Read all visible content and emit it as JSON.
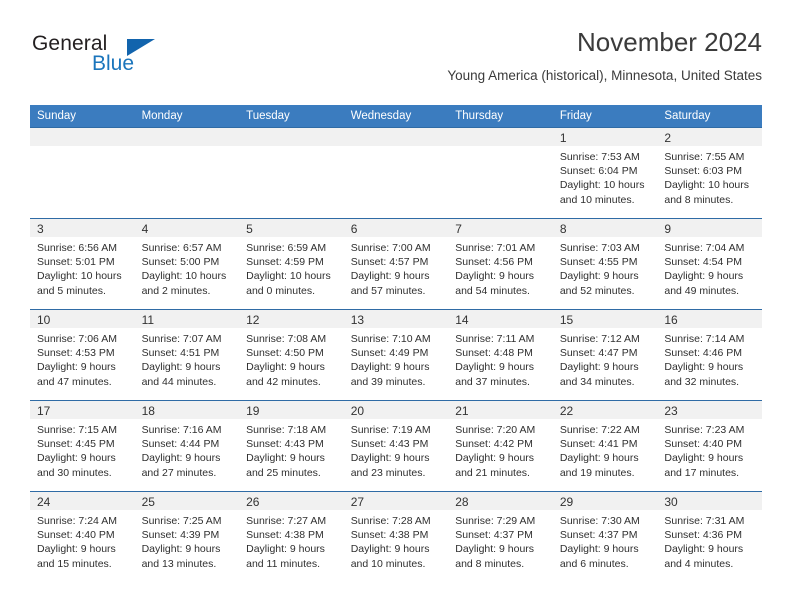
{
  "brand": {
    "name_top": "General",
    "name_bottom": "Blue",
    "triangle_color": "#1264ad",
    "blue_color": "#1b75bc"
  },
  "header": {
    "title": "November 2024",
    "location": "Young America (historical), Minnesota, United States"
  },
  "theme": {
    "header_row_bg": "#3b7cbf",
    "header_row_text": "#ffffff",
    "daynum_strip_bg": "#f1f1f1",
    "row_divider": "#2f6ba5"
  },
  "calendar": {
    "weekday_headers": [
      "Sunday",
      "Monday",
      "Tuesday",
      "Wednesday",
      "Thursday",
      "Friday",
      "Saturday"
    ],
    "weeks": [
      [
        {
          "day": "",
          "sunrise": "",
          "sunset": "",
          "daylight_line1": "",
          "daylight_line2": ""
        },
        {
          "day": "",
          "sunrise": "",
          "sunset": "",
          "daylight_line1": "",
          "daylight_line2": ""
        },
        {
          "day": "",
          "sunrise": "",
          "sunset": "",
          "daylight_line1": "",
          "daylight_line2": ""
        },
        {
          "day": "",
          "sunrise": "",
          "sunset": "",
          "daylight_line1": "",
          "daylight_line2": ""
        },
        {
          "day": "",
          "sunrise": "",
          "sunset": "",
          "daylight_line1": "",
          "daylight_line2": ""
        },
        {
          "day": "1",
          "sunrise": "Sunrise: 7:53 AM",
          "sunset": "Sunset: 6:04 PM",
          "daylight_line1": "Daylight: 10 hours",
          "daylight_line2": "and 10 minutes."
        },
        {
          "day": "2",
          "sunrise": "Sunrise: 7:55 AM",
          "sunset": "Sunset: 6:03 PM",
          "daylight_line1": "Daylight: 10 hours",
          "daylight_line2": "and 8 minutes."
        }
      ],
      [
        {
          "day": "3",
          "sunrise": "Sunrise: 6:56 AM",
          "sunset": "Sunset: 5:01 PM",
          "daylight_line1": "Daylight: 10 hours",
          "daylight_line2": "and 5 minutes."
        },
        {
          "day": "4",
          "sunrise": "Sunrise: 6:57 AM",
          "sunset": "Sunset: 5:00 PM",
          "daylight_line1": "Daylight: 10 hours",
          "daylight_line2": "and 2 minutes."
        },
        {
          "day": "5",
          "sunrise": "Sunrise: 6:59 AM",
          "sunset": "Sunset: 4:59 PM",
          "daylight_line1": "Daylight: 10 hours",
          "daylight_line2": "and 0 minutes."
        },
        {
          "day": "6",
          "sunrise": "Sunrise: 7:00 AM",
          "sunset": "Sunset: 4:57 PM",
          "daylight_line1": "Daylight: 9 hours",
          "daylight_line2": "and 57 minutes."
        },
        {
          "day": "7",
          "sunrise": "Sunrise: 7:01 AM",
          "sunset": "Sunset: 4:56 PM",
          "daylight_line1": "Daylight: 9 hours",
          "daylight_line2": "and 54 minutes."
        },
        {
          "day": "8",
          "sunrise": "Sunrise: 7:03 AM",
          "sunset": "Sunset: 4:55 PM",
          "daylight_line1": "Daylight: 9 hours",
          "daylight_line2": "and 52 minutes."
        },
        {
          "day": "9",
          "sunrise": "Sunrise: 7:04 AM",
          "sunset": "Sunset: 4:54 PM",
          "daylight_line1": "Daylight: 9 hours",
          "daylight_line2": "and 49 minutes."
        }
      ],
      [
        {
          "day": "10",
          "sunrise": "Sunrise: 7:06 AM",
          "sunset": "Sunset: 4:53 PM",
          "daylight_line1": "Daylight: 9 hours",
          "daylight_line2": "and 47 minutes."
        },
        {
          "day": "11",
          "sunrise": "Sunrise: 7:07 AM",
          "sunset": "Sunset: 4:51 PM",
          "daylight_line1": "Daylight: 9 hours",
          "daylight_line2": "and 44 minutes."
        },
        {
          "day": "12",
          "sunrise": "Sunrise: 7:08 AM",
          "sunset": "Sunset: 4:50 PM",
          "daylight_line1": "Daylight: 9 hours",
          "daylight_line2": "and 42 minutes."
        },
        {
          "day": "13",
          "sunrise": "Sunrise: 7:10 AM",
          "sunset": "Sunset: 4:49 PM",
          "daylight_line1": "Daylight: 9 hours",
          "daylight_line2": "and 39 minutes."
        },
        {
          "day": "14",
          "sunrise": "Sunrise: 7:11 AM",
          "sunset": "Sunset: 4:48 PM",
          "daylight_line1": "Daylight: 9 hours",
          "daylight_line2": "and 37 minutes."
        },
        {
          "day": "15",
          "sunrise": "Sunrise: 7:12 AM",
          "sunset": "Sunset: 4:47 PM",
          "daylight_line1": "Daylight: 9 hours",
          "daylight_line2": "and 34 minutes."
        },
        {
          "day": "16",
          "sunrise": "Sunrise: 7:14 AM",
          "sunset": "Sunset: 4:46 PM",
          "daylight_line1": "Daylight: 9 hours",
          "daylight_line2": "and 32 minutes."
        }
      ],
      [
        {
          "day": "17",
          "sunrise": "Sunrise: 7:15 AM",
          "sunset": "Sunset: 4:45 PM",
          "daylight_line1": "Daylight: 9 hours",
          "daylight_line2": "and 30 minutes."
        },
        {
          "day": "18",
          "sunrise": "Sunrise: 7:16 AM",
          "sunset": "Sunset: 4:44 PM",
          "daylight_line1": "Daylight: 9 hours",
          "daylight_line2": "and 27 minutes."
        },
        {
          "day": "19",
          "sunrise": "Sunrise: 7:18 AM",
          "sunset": "Sunset: 4:43 PM",
          "daylight_line1": "Daylight: 9 hours",
          "daylight_line2": "and 25 minutes."
        },
        {
          "day": "20",
          "sunrise": "Sunrise: 7:19 AM",
          "sunset": "Sunset: 4:43 PM",
          "daylight_line1": "Daylight: 9 hours",
          "daylight_line2": "and 23 minutes."
        },
        {
          "day": "21",
          "sunrise": "Sunrise: 7:20 AM",
          "sunset": "Sunset: 4:42 PM",
          "daylight_line1": "Daylight: 9 hours",
          "daylight_line2": "and 21 minutes."
        },
        {
          "day": "22",
          "sunrise": "Sunrise: 7:22 AM",
          "sunset": "Sunset: 4:41 PM",
          "daylight_line1": "Daylight: 9 hours",
          "daylight_line2": "and 19 minutes."
        },
        {
          "day": "23",
          "sunrise": "Sunrise: 7:23 AM",
          "sunset": "Sunset: 4:40 PM",
          "daylight_line1": "Daylight: 9 hours",
          "daylight_line2": "and 17 minutes."
        }
      ],
      [
        {
          "day": "24",
          "sunrise": "Sunrise: 7:24 AM",
          "sunset": "Sunset: 4:40 PM",
          "daylight_line1": "Daylight: 9 hours",
          "daylight_line2": "and 15 minutes."
        },
        {
          "day": "25",
          "sunrise": "Sunrise: 7:25 AM",
          "sunset": "Sunset: 4:39 PM",
          "daylight_line1": "Daylight: 9 hours",
          "daylight_line2": "and 13 minutes."
        },
        {
          "day": "26",
          "sunrise": "Sunrise: 7:27 AM",
          "sunset": "Sunset: 4:38 PM",
          "daylight_line1": "Daylight: 9 hours",
          "daylight_line2": "and 11 minutes."
        },
        {
          "day": "27",
          "sunrise": "Sunrise: 7:28 AM",
          "sunset": "Sunset: 4:38 PM",
          "daylight_line1": "Daylight: 9 hours",
          "daylight_line2": "and 10 minutes."
        },
        {
          "day": "28",
          "sunrise": "Sunrise: 7:29 AM",
          "sunset": "Sunset: 4:37 PM",
          "daylight_line1": "Daylight: 9 hours",
          "daylight_line2": "and 8 minutes."
        },
        {
          "day": "29",
          "sunrise": "Sunrise: 7:30 AM",
          "sunset": "Sunset: 4:37 PM",
          "daylight_line1": "Daylight: 9 hours",
          "daylight_line2": "and 6 minutes."
        },
        {
          "day": "30",
          "sunrise": "Sunrise: 7:31 AM",
          "sunset": "Sunset: 4:36 PM",
          "daylight_line1": "Daylight: 9 hours",
          "daylight_line2": "and 4 minutes."
        }
      ]
    ]
  }
}
